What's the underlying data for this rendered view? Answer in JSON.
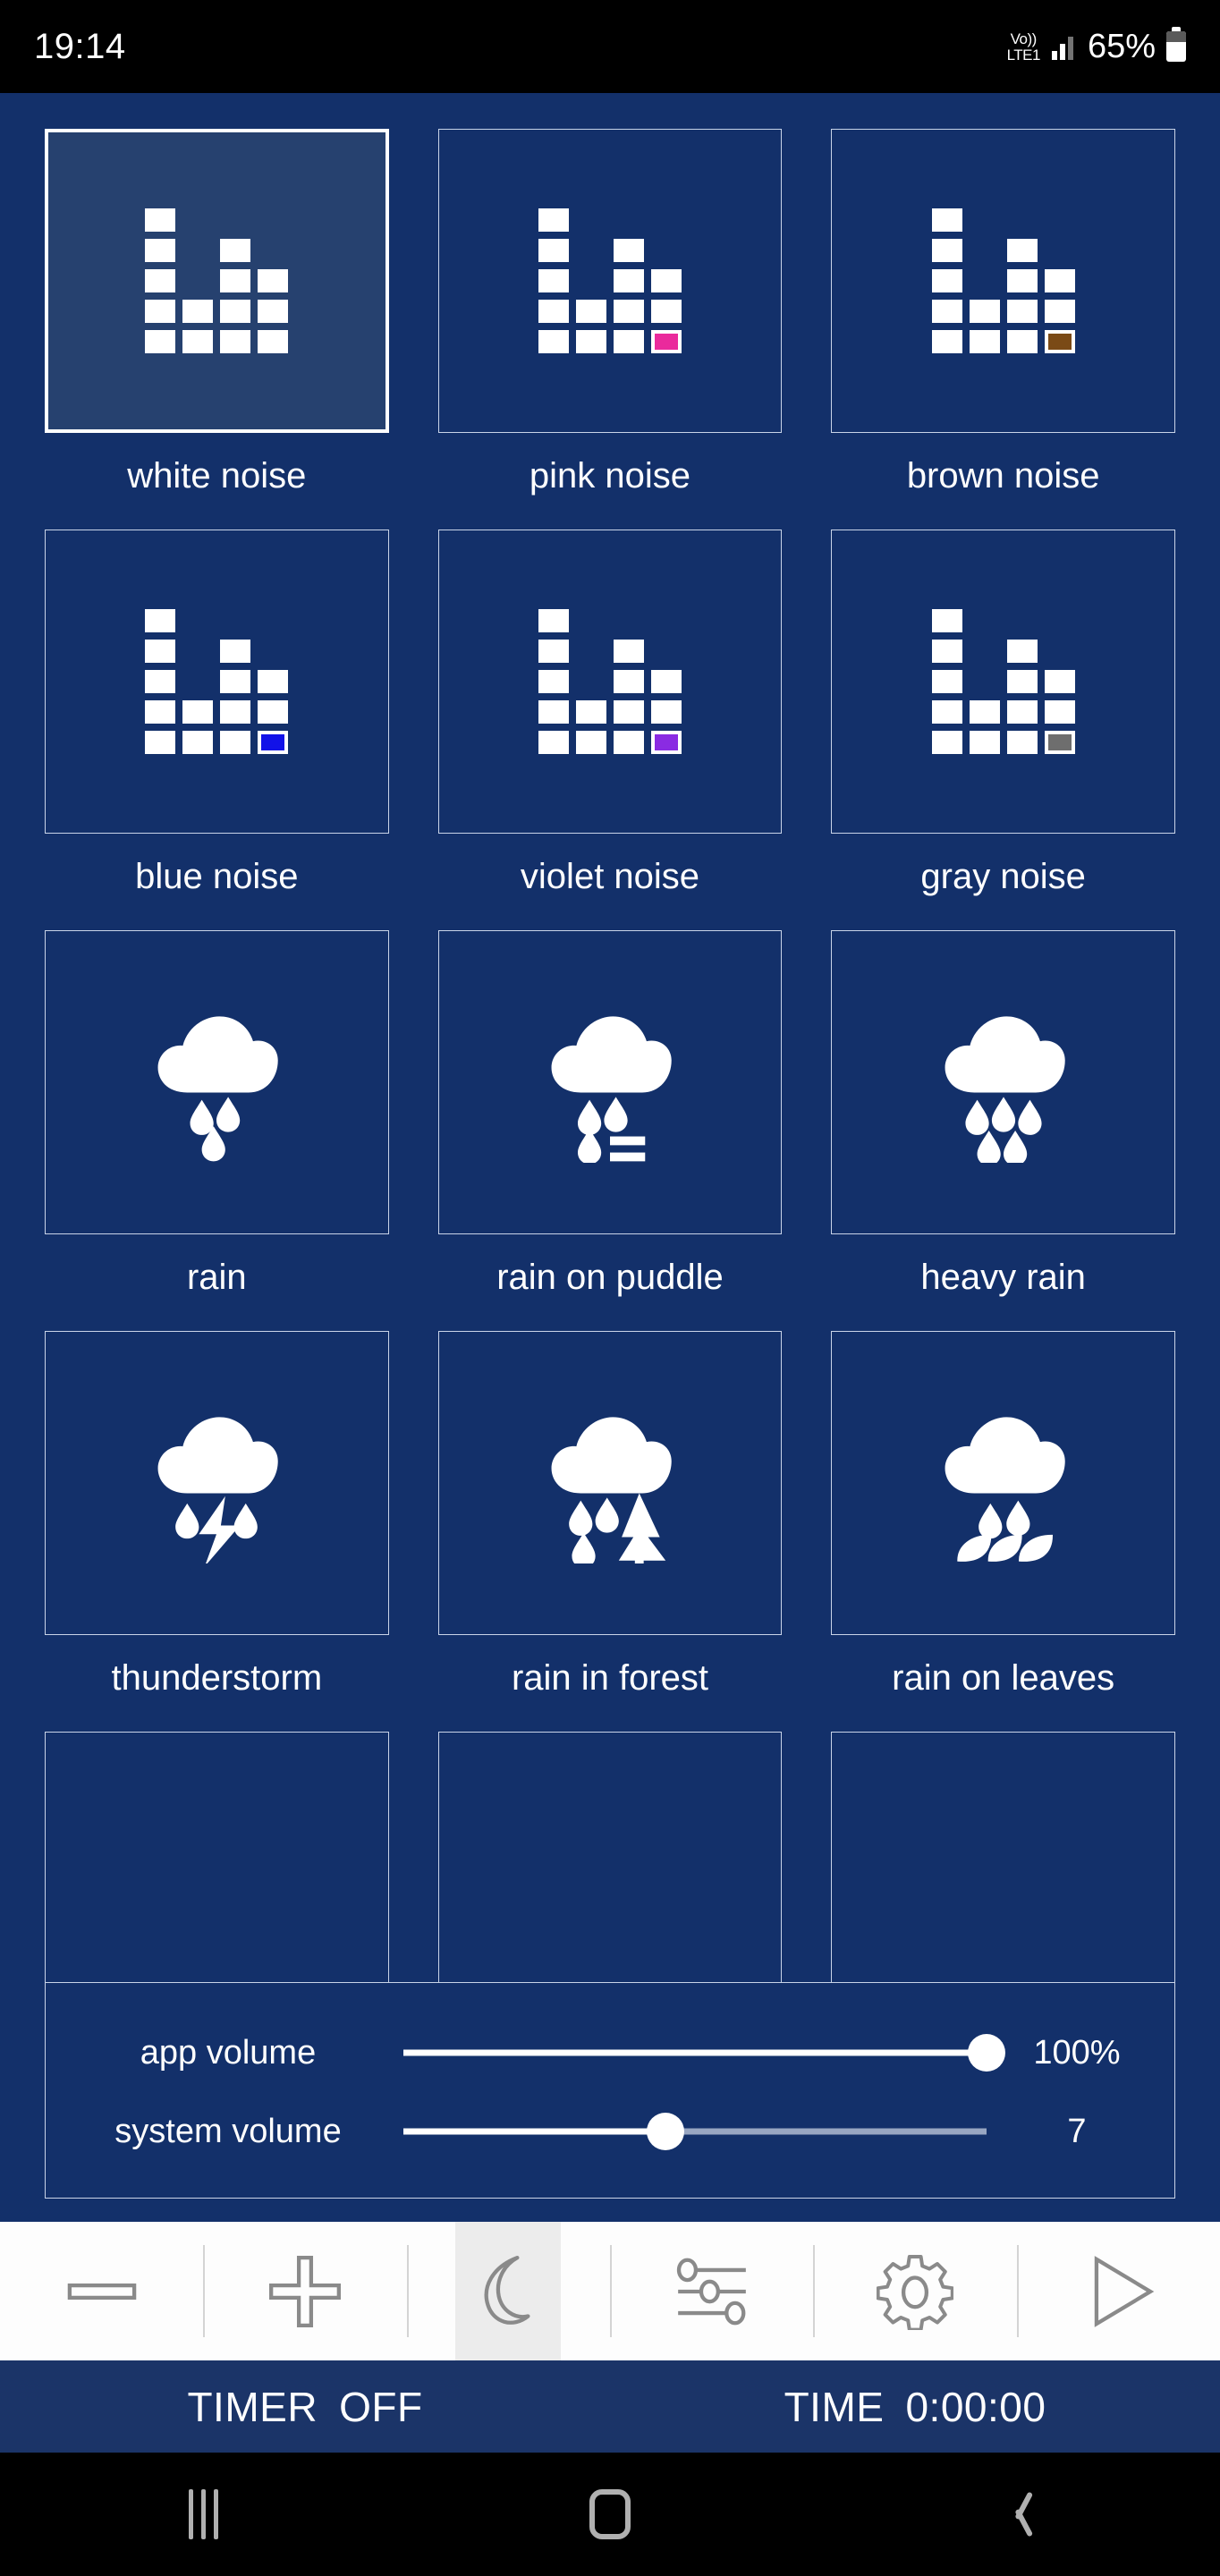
{
  "status_bar": {
    "time": "19:14",
    "volte_top": "Vo))",
    "volte_bottom": "LTE1",
    "battery_percent": "65%"
  },
  "colors": {
    "page_background": "#13306a",
    "tile_border": "#c9d4e8",
    "selected_tile_background": "#26416f",
    "toolbar_background": "#fdfdfd",
    "timer_bar_background": "#1b3468",
    "accent_pink": "#ea2a9c",
    "accent_brown": "#7a4a16",
    "accent_blue": "#1212e8",
    "accent_violet": "#8a2be2",
    "accent_gray": "#6e6e6e"
  },
  "sounds": [
    {
      "label": "white noise",
      "icon": "equalizer-icon",
      "accent": null,
      "selected": true
    },
    {
      "label": "pink noise",
      "icon": "equalizer-icon",
      "accent": "#ea2a9c",
      "selected": false
    },
    {
      "label": "brown noise",
      "icon": "equalizer-icon",
      "accent": "#7a4a16",
      "selected": false
    },
    {
      "label": "blue noise",
      "icon": "equalizer-icon",
      "accent": "#1212e8",
      "selected": false
    },
    {
      "label": "violet noise",
      "icon": "equalizer-icon",
      "accent": "#8a2be2",
      "selected": false
    },
    {
      "label": "gray noise",
      "icon": "equalizer-icon",
      "accent": "#6e6e6e",
      "selected": false
    },
    {
      "label": "rain",
      "icon": "rain-cloud-icon",
      "accent": null,
      "selected": false
    },
    {
      "label": "rain on puddle",
      "icon": "rain-puddle-icon",
      "accent": null,
      "selected": false
    },
    {
      "label": "heavy rain",
      "icon": "heavy-rain-icon",
      "accent": null,
      "selected": false
    },
    {
      "label": "thunderstorm",
      "icon": "thunderstorm-icon",
      "accent": null,
      "selected": false
    },
    {
      "label": "rain in forest",
      "icon": "rain-forest-icon",
      "accent": null,
      "selected": false
    },
    {
      "label": "rain on leaves",
      "icon": "rain-leaves-icon",
      "accent": null,
      "selected": false
    },
    {
      "label": "",
      "icon": "empty-icon",
      "accent": null,
      "selected": false
    },
    {
      "label": "",
      "icon": "empty-icon",
      "accent": null,
      "selected": false
    },
    {
      "label": "",
      "icon": "empty-icon",
      "accent": null,
      "selected": false
    }
  ],
  "volume_panel": {
    "app_volume": {
      "label": "app volume",
      "value_text": "100%",
      "percent": 100
    },
    "system_volume": {
      "label": "system volume",
      "value_text": "7",
      "percent": 45
    }
  },
  "toolbar": [
    {
      "name": "minus-icon",
      "label": "minus"
    },
    {
      "name": "plus-icon",
      "label": "plus"
    },
    {
      "name": "moon-icon",
      "label": "night mode",
      "active": true
    },
    {
      "name": "sliders-icon",
      "label": "mixer"
    },
    {
      "name": "gear-icon",
      "label": "settings"
    },
    {
      "name": "play-icon",
      "label": "play"
    }
  ],
  "timer_bar": {
    "timer_label": "TIMER",
    "timer_value": "OFF",
    "time_label": "TIME",
    "time_value": "0:00:00"
  },
  "nav_bar": {
    "recents": "recents",
    "home": "home",
    "back": "back"
  }
}
